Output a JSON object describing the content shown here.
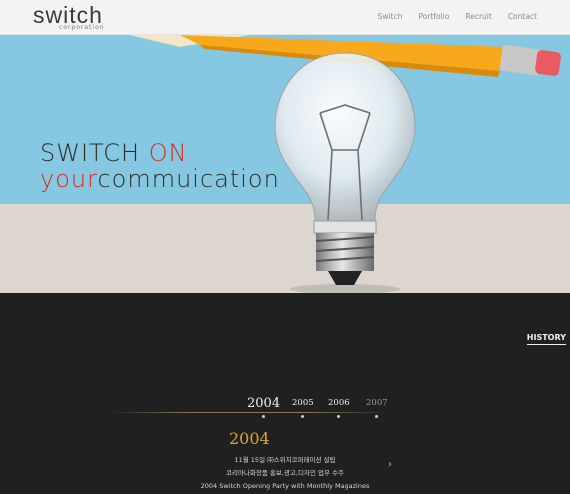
{
  "header": {
    "logo": {
      "main": "switch",
      "sub": "corporation"
    },
    "nav": [
      "Switch",
      "Portfolio",
      "Recruit",
      "Contact"
    ]
  },
  "hero": {
    "tagline_line1": {
      "part1": "SWITCH ",
      "part2": "ON"
    },
    "tagline_line2": {
      "part1": "your",
      "part2": "commuication"
    }
  },
  "history": {
    "label": "HISTORY",
    "years": [
      "2004",
      "2005",
      "2006",
      "2007"
    ],
    "selected_year": "2004",
    "events": [
      "11월 15일 ㈜스위치코퍼레이션 설립",
      "코리아나화장품 홍보,광고,디자인 업무 수주",
      "2004 Switch Opening Party with Monthly Magazines"
    ],
    "next_arrow": "›"
  },
  "colors": {
    "accent_red": "#d62c27",
    "accent_gold": "#d9a828",
    "sky": "#86c7e1"
  }
}
